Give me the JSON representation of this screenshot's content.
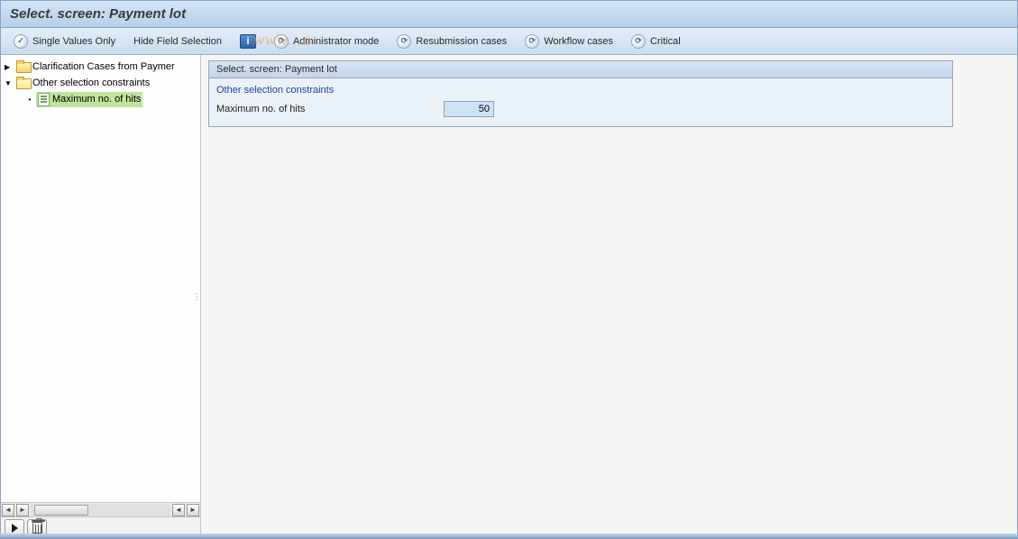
{
  "title": "Select. screen: Payment lot",
  "watermark": "www.             .a",
  "toolbar": {
    "single_values": "Single Values Only",
    "hide_field": "Hide Field Selection",
    "admin_mode": "Administrator mode",
    "resubmission": "Resubmission cases",
    "workflow": "Workflow cases",
    "critical": "Critical"
  },
  "tree": {
    "node1": {
      "label": "Clarification Cases from Paymer"
    },
    "node2": {
      "label": "Other selection constraints"
    },
    "node2_1": {
      "label": "Maximum no. of hits"
    }
  },
  "panel": {
    "header": "Select. screen: Payment lot",
    "section": "Other selection constraints",
    "field_label": "Maximum no. of hits",
    "field_value": "50"
  }
}
